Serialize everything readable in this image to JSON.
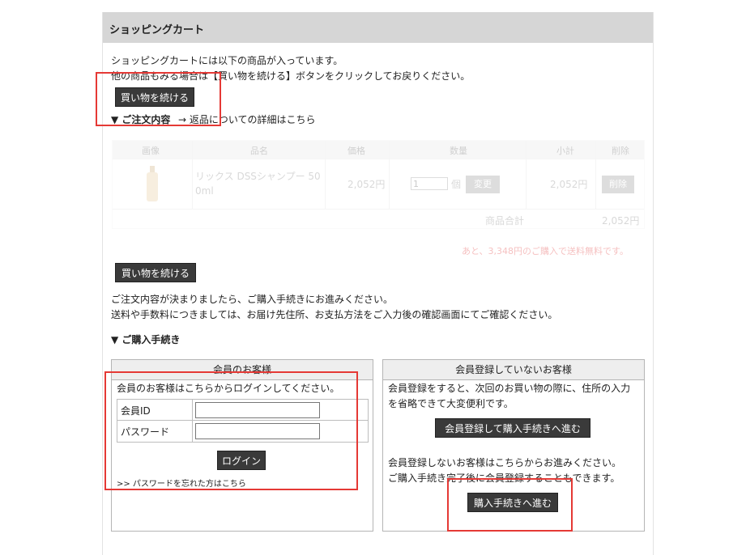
{
  "cart": {
    "title": "ショッピングカート",
    "intro_line1": "ショッピングカートには以下の商品が入っています。",
    "intro_line2": "他の商品もみる場合は【買い物を続ける】ボタンをクリックしてお戻りください。",
    "continue_label": "買い物を続ける",
    "order_section_title": "▼ ご注文内容",
    "returns_link": "→ 返品についての詳細はこちら",
    "table": {
      "headers": [
        "画像",
        "品名",
        "価格",
        "数量",
        "小計",
        "削除"
      ],
      "item": {
        "name_line1": "リックス DSSシャンプー 50",
        "name_line2": "0ml",
        "price": "2,052円",
        "qty": "1",
        "qty_unit": "個",
        "change_label": "変更",
        "subtotal": "2,052円",
        "delete_label": "削除"
      },
      "total_label": "商品合計",
      "total_value": "2,052円"
    },
    "shipping_note": "あと、3,348円のご購入で送料無料です。",
    "continue_label_2": "買い物を続ける",
    "proceed_line1": "ご注文内容が決まりましたら、ご購入手続きにお進みください。",
    "proceed_line2": "送料や手数料につきましては、お届け先住所、お支払方法をご入力後の確認画面にてご確認ください。",
    "checkout_section_title": "▼ ご購入手続き"
  },
  "member": {
    "header": "会員のお客様",
    "desc": "会員のお客様はこちらからログインしてください。",
    "id_label": "会員ID",
    "password_label": "パスワード",
    "login_label": "ログイン",
    "forgot_link": ">> パスワードを忘れた方はこちら"
  },
  "guest": {
    "header": "会員登録していないお客様",
    "desc_line1": "会員登録をすると、次回のお買い物の際に、住所の入力",
    "desc_line2": "を省略できて大変便利です。",
    "register_label": "会員登録して購入手続きへ進む",
    "desc2_line1": "会員登録しないお客様はこちらからお進みください。",
    "desc2_line2": "ご購入手続き完了後に会員登録することもできます。",
    "proceed_label": "購入手続きへ進む"
  },
  "colors": {
    "header_bg": "#d6d6d6",
    "button_bg": "#3a3a3a",
    "highlight": "#e53935",
    "shipping_note": "#e03030"
  }
}
